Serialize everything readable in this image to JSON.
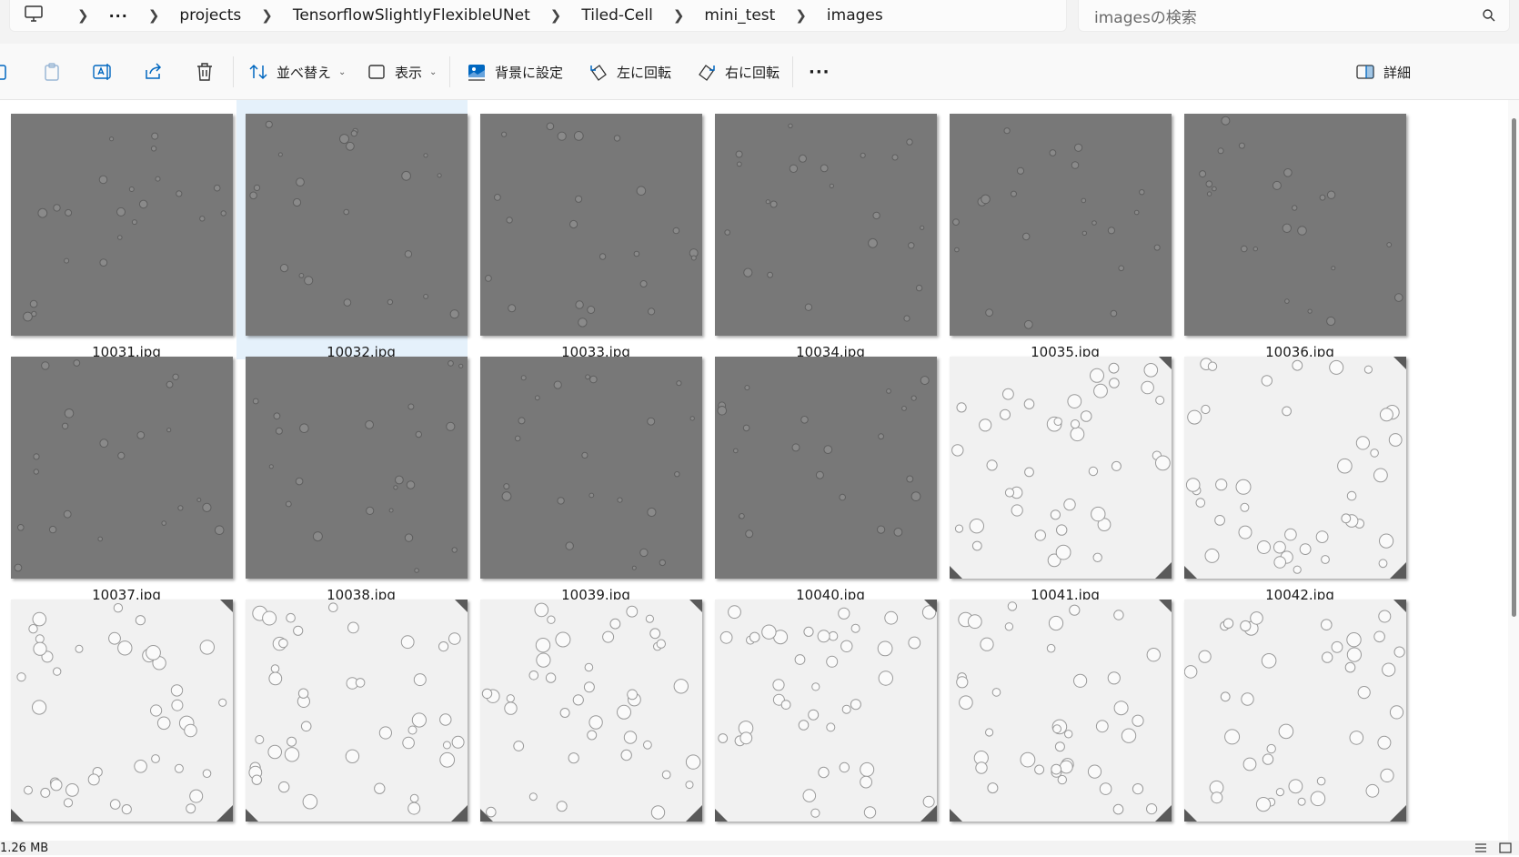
{
  "breadcrumb": {
    "overflow": "···",
    "items": [
      "projects",
      "TensorflowSlightlyFlexibleUNet",
      "Tiled-Cell",
      "mini_test",
      "images"
    ]
  },
  "search": {
    "placeholder": "imagesの検索"
  },
  "toolbar": {
    "sort_label": "並べ替え",
    "view_label": "表示",
    "set_background_label": "背景に設定",
    "rotate_left_label": "左に回転",
    "rotate_right_label": "右に回転",
    "more_label": "···",
    "details_label": "詳細"
  },
  "files": [
    {
      "name": "10031.jpg",
      "style": "dark",
      "selected": false
    },
    {
      "name": "10032.jpg",
      "style": "dark",
      "selected": true
    },
    {
      "name": "10033.jpg",
      "style": "dark",
      "selected": false
    },
    {
      "name": "10034.jpg",
      "style": "dark",
      "selected": false
    },
    {
      "name": "10035.jpg",
      "style": "dark",
      "selected": false
    },
    {
      "name": "10036.jpg",
      "style": "dark",
      "selected": false
    },
    {
      "name": "10037.jpg",
      "style": "dark",
      "selected": false
    },
    {
      "name": "10038.jpg",
      "style": "dark",
      "selected": false
    },
    {
      "name": "10039.jpg",
      "style": "dark",
      "selected": false
    },
    {
      "name": "10040.jpg",
      "style": "dark",
      "selected": false
    },
    {
      "name": "10041.jpg",
      "style": "light",
      "selected": false
    },
    {
      "name": "10042.jpg",
      "style": "light",
      "selected": false
    },
    {
      "name": "",
      "style": "light",
      "selected": false
    },
    {
      "name": "",
      "style": "light",
      "selected": false
    },
    {
      "name": "",
      "style": "light",
      "selected": false
    },
    {
      "name": "",
      "style": "light",
      "selected": false
    },
    {
      "name": "",
      "style": "light",
      "selected": false
    },
    {
      "name": "",
      "style": "light",
      "selected": false
    }
  ],
  "status": {
    "size_text": "1.26 MB"
  },
  "colors": {
    "selected_bg": "#e5f1fb",
    "dark_thumb": "#787878",
    "light_thumb": "#f1f1f1",
    "accent": "#0067c0"
  }
}
